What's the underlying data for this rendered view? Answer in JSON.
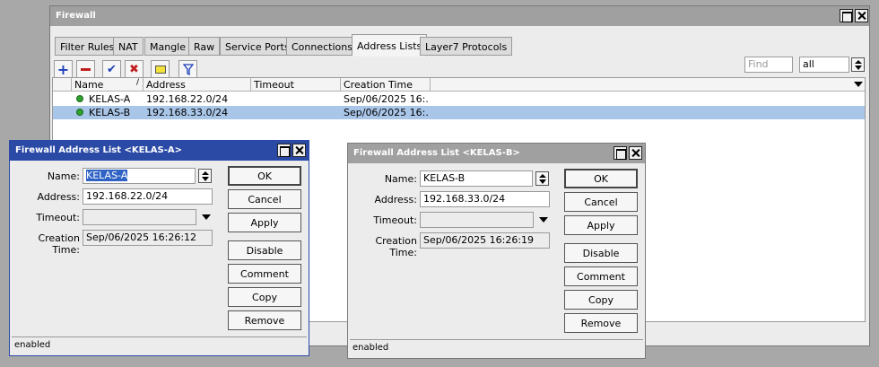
{
  "main_window": {
    "title": "Firewall",
    "tabs": [
      {
        "label": "Filter Rules"
      },
      {
        "label": "NAT"
      },
      {
        "label": "Mangle"
      },
      {
        "label": "Raw"
      },
      {
        "label": "Service Ports"
      },
      {
        "label": "Connections"
      },
      {
        "label": "Address Lists"
      },
      {
        "label": "Layer7 Protocols"
      }
    ],
    "selected_tab": "Address Lists",
    "find_placeholder": "Find",
    "filter_value": "all",
    "columns": [
      "Name",
      "Address",
      "Timeout",
      "Creation Time"
    ],
    "rows": [
      {
        "name": "KELAS-A",
        "address": "192.168.22.0/24",
        "timeout": "",
        "creation": "Sep/06/2025 16:..."
      },
      {
        "name": "KELAS-B",
        "address": "192.168.33.0/24",
        "timeout": "",
        "creation": "Sep/06/2025 16:..."
      }
    ]
  },
  "dialog_a": {
    "title": "Firewall Address List <KELAS-A>",
    "name_label": "Name:",
    "name_value": "KELAS-A",
    "address_label": "Address:",
    "address_value": "192.168.22.0/24",
    "timeout_label": "Timeout:",
    "creation_label": "Creation Time:",
    "creation_value": "Sep/06/2025 16:26:12",
    "status": "enabled"
  },
  "dialog_b": {
    "title": "Firewall Address List <KELAS-B>",
    "name_label": "Name:",
    "name_value": "KELAS-B",
    "address_label": "Address:",
    "address_value": "192.168.33.0/24",
    "timeout_label": "Timeout:",
    "creation_label": "Creation Time:",
    "creation_value": "Sep/06/2025 16:26:19",
    "status": "enabled"
  },
  "buttons": {
    "ok": "OK",
    "cancel": "Cancel",
    "apply": "Apply",
    "disable": "Disable",
    "comment": "Comment",
    "copy": "Copy",
    "remove": "Remove"
  },
  "icons": {
    "add": "add-icon",
    "remove": "remove-icon",
    "enable": "check-icon",
    "disable": "x-icon",
    "comment": "comment-icon",
    "filter": "filter-icon"
  },
  "colors": {
    "active_title": "#2a4aa6",
    "inactive_title": "#a0a0a0",
    "selected_row": "#a9c6e8",
    "enabled_dot": "#2ea02e"
  }
}
